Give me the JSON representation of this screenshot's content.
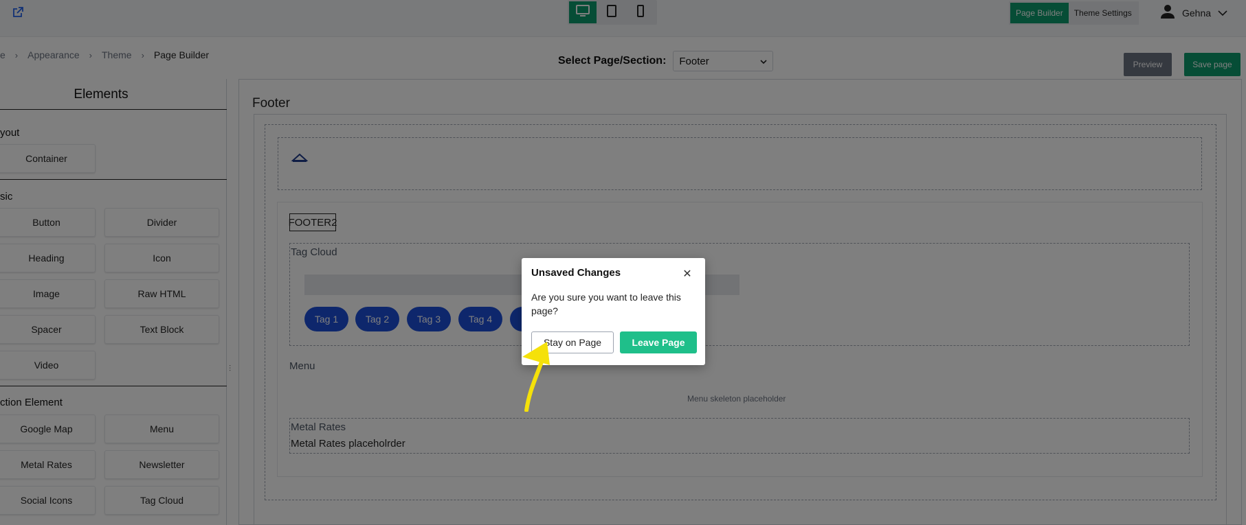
{
  "topbar": {
    "devices": [
      "desktop-icon",
      "tablet-icon",
      "mobile-icon"
    ],
    "modes": [
      "Page Builder",
      "Theme Settings"
    ],
    "user_name": "Gehna"
  },
  "breadcrumb": [
    "e",
    "Appearance",
    "Theme",
    "Page Builder"
  ],
  "page_select": {
    "label": "Select Page/Section:",
    "value": "Footer"
  },
  "actions": {
    "preview": "Preview",
    "save": "Save page"
  },
  "elements_panel": {
    "title": "Elements",
    "sections": [
      {
        "label": "yout",
        "items": [
          "Container"
        ]
      },
      {
        "label": "sic",
        "items": [
          "Button",
          "Divider",
          "Heading",
          "Icon",
          "Image",
          "Raw HTML",
          "Spacer",
          "Text Block",
          "Video"
        ]
      },
      {
        "label": "ction Element",
        "items": [
          "Google Map",
          "Menu",
          "Metal Rates",
          "Newsletter",
          "Social Icons",
          "Tag Cloud"
        ]
      }
    ]
  },
  "canvas": {
    "title": "Footer",
    "footer_label": "FOOTER2",
    "tag_cloud_label": "Tag Cloud",
    "tags": [
      "Tag 1",
      "Tag 2",
      "Tag 3",
      "Tag 4"
    ],
    "menu_label": "Menu",
    "menu_placeholder": "Menu skeleton placeholder",
    "metal_label": "Metal Rates",
    "metal_placeholder": "Metal Rates placeholrder"
  },
  "modal": {
    "title": "Unsaved Changes",
    "body": "Are you sure you want to leave this page?",
    "stay": "Stay on Page",
    "leave": "Leave Page"
  },
  "colors": {
    "accent": "#0d9b6c",
    "leave_button": "#1fbf8a",
    "tag_pill": "#1d4ed8",
    "annotation": "#f5e10a"
  }
}
